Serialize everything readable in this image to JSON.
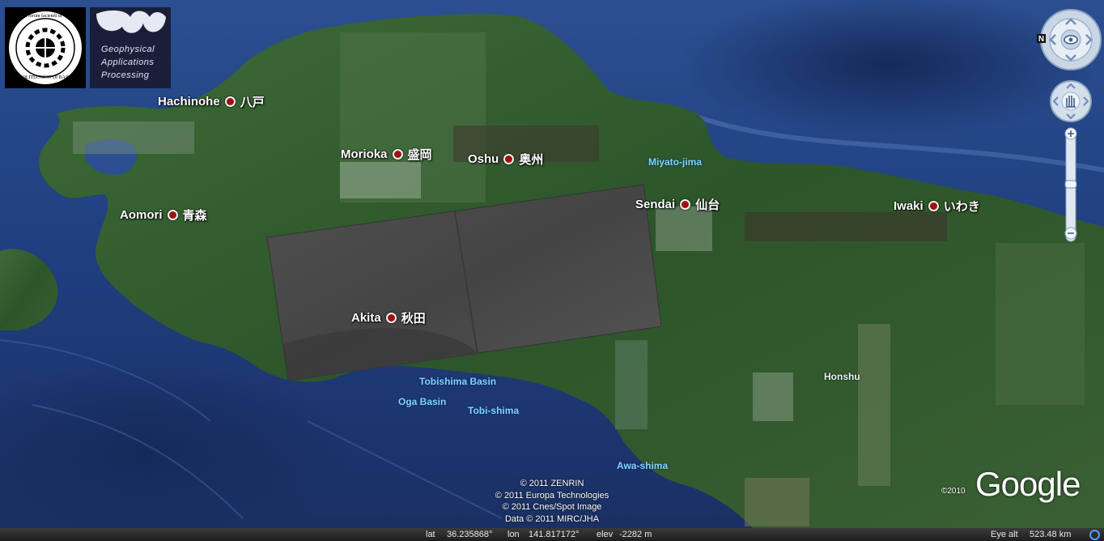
{
  "logos": {
    "left_ring_text": "de rerum faciendi ut",
    "left_bottom_text": "POLITECNICO DI BARI",
    "right_title": [
      "Geophysical",
      "Applications",
      "Processing"
    ]
  },
  "places": [
    {
      "id": "hachinohe",
      "name": "Hachinohe",
      "native": "八戸"
    },
    {
      "id": "morioka",
      "name": "Morioka",
      "native": "盛岡"
    },
    {
      "id": "oshu",
      "name": "Oshu",
      "native": "奥州"
    },
    {
      "id": "aomori",
      "name": "Aomori",
      "native": "青森"
    },
    {
      "id": "sendai",
      "name": "Sendai",
      "native": "仙台"
    },
    {
      "id": "iwaki",
      "name": "Iwaki",
      "native": "いわき"
    },
    {
      "id": "akita",
      "name": "Akita",
      "native": "秋田"
    }
  ],
  "water_labels": {
    "miyato": "Miyato-jima",
    "tobishima_basin": "Tobishima Basin",
    "oga_basin": "Oga Basin",
    "tobi_shima": "Tobi-shima",
    "awa_shima": "Awa-shima"
  },
  "land_labels": {
    "honshu": "Honshu"
  },
  "credits": [
    "© 2011 ZENRIN",
    "© 2011 Europa Technologies",
    "© 2011 Cnes/Spot Image",
    "Data © 2011 MIRC/JHA"
  ],
  "branding": {
    "google": "Google",
    "copyright_year": "©2010"
  },
  "nav": {
    "north_label": "N"
  },
  "status": {
    "lat_label": "lat",
    "lat_value": "36.235868°",
    "lon_label": "lon",
    "lon_value": "141.817172°",
    "elev_label": "elev",
    "elev_value": "-2282 m",
    "eye_label": "Eye alt",
    "eye_value": "523.48 km"
  },
  "colors": {
    "ocean": "#1c3c78",
    "land": "#2f5a2c",
    "overlay": "#4a4a4a",
    "place_dot": "#a01010"
  }
}
